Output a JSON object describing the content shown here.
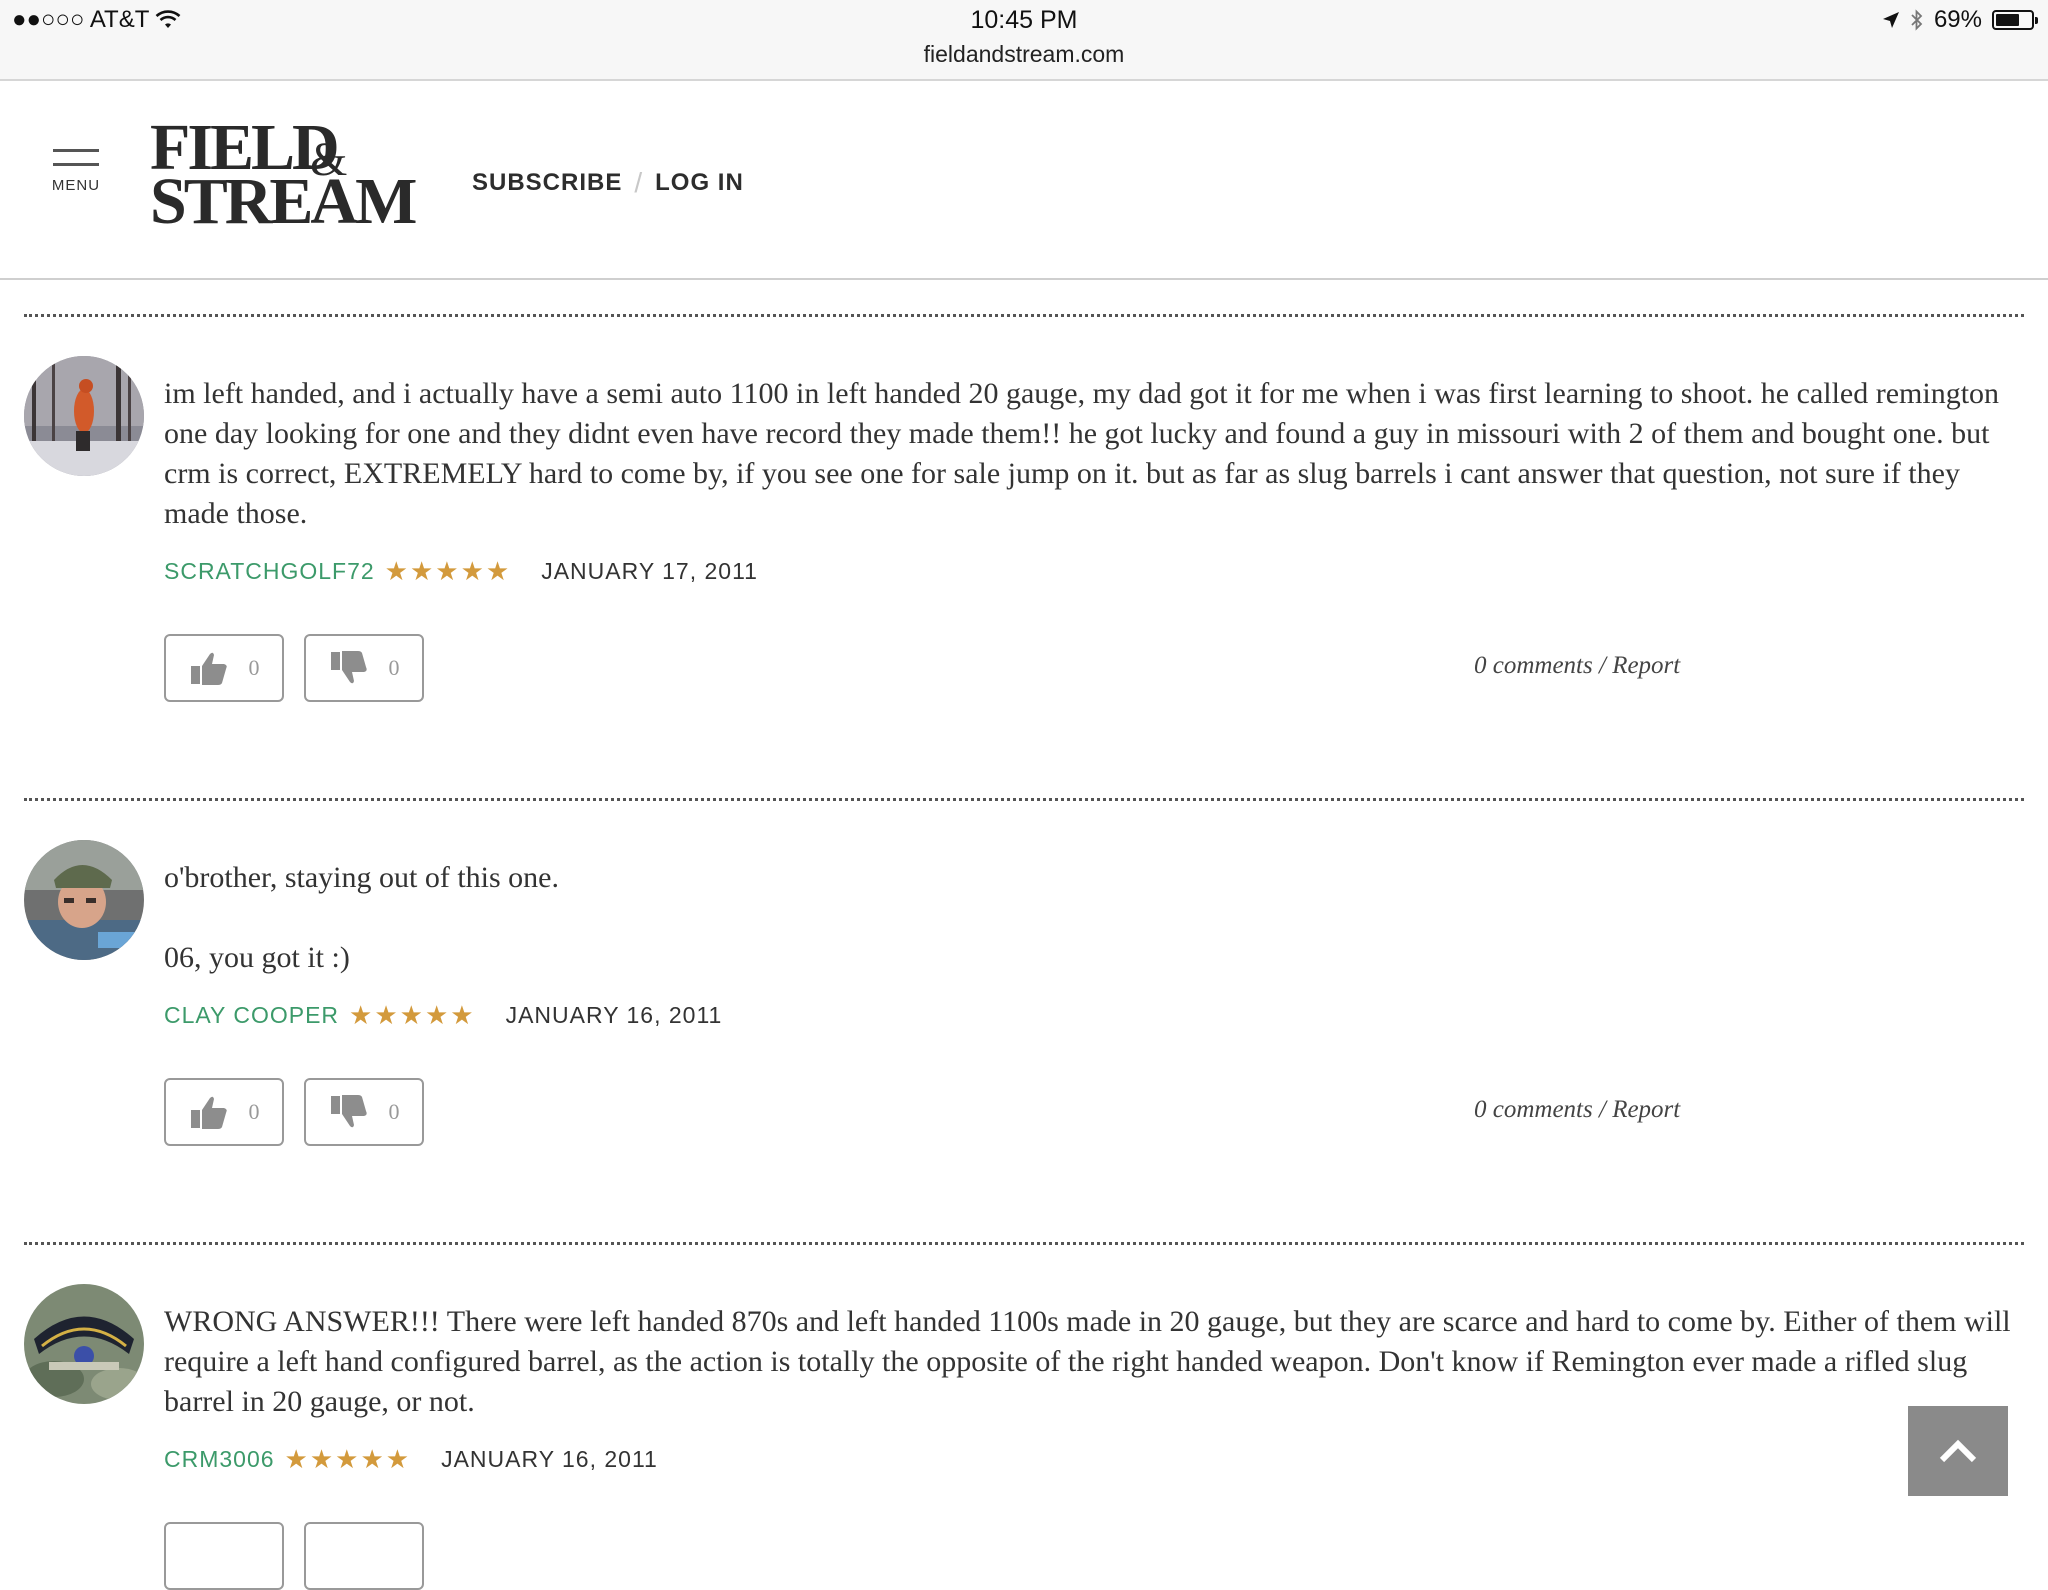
{
  "status_bar": {
    "carrier": "●●○○○ AT&T",
    "time": "10:45 PM",
    "battery": "69%",
    "battery_level": 0.69,
    "url": "fieldandstream.com"
  },
  "header": {
    "menu_label": "MENU",
    "logo_line1": "FIELD",
    "logo_amp": "&",
    "logo_line2": "STREAM",
    "subscribe_label": "SUBSCRIBE",
    "separator": "/",
    "login_label": "LOG IN"
  },
  "comments": [
    {
      "text": "im left handed, and i actually have a semi auto 1100 in left handed 20 gauge, my dad got it for me when i was first learning to shoot. he called remington one day looking for one and they didnt even have record they made them!! he got lucky and found a guy in missouri with 2 of them and bought one. but crm is correct, EXTREMELY hard to come by, if you see one for sale jump on it. but as far as slug barrels i cant answer that question, not sure if they made those.",
      "author": "SCRATCHGOLF72",
      "rating": 5,
      "stars": "★★★★★",
      "date": "JANUARY 17, 2011",
      "up_votes": "0",
      "down_votes": "0",
      "comments_link": "0 comments",
      "report_link": "Report"
    },
    {
      "text_p1": "o'brother, staying out of this one.",
      "text_p2": "06, you got it :)",
      "author": "CLAY COOPER",
      "rating": 5,
      "stars": "★★★★★",
      "date": "JANUARY 16, 2011",
      "up_votes": "0",
      "down_votes": "0",
      "comments_link": "0 comments",
      "report_link": "Report"
    },
    {
      "text": "WRONG ANSWER!!! There were left handed 870s and left handed 1100s made in 20 gauge, but they are scarce and hard to come by. Either of them will require a left hand configured barrel, as the action is totally the opposite of the right handed weapon. Don't know if Remington ever made a rifled slug barrel in 20 gauge, or not.",
      "author": "CRM3006",
      "rating": 5,
      "stars": "★★★★★",
      "date": "JANUARY 16, 2011"
    }
  ],
  "colors": {
    "author_green": "#3c9a6a",
    "star_gold": "#d39a3c",
    "back_to_top_bg": "#8a8a8a"
  }
}
